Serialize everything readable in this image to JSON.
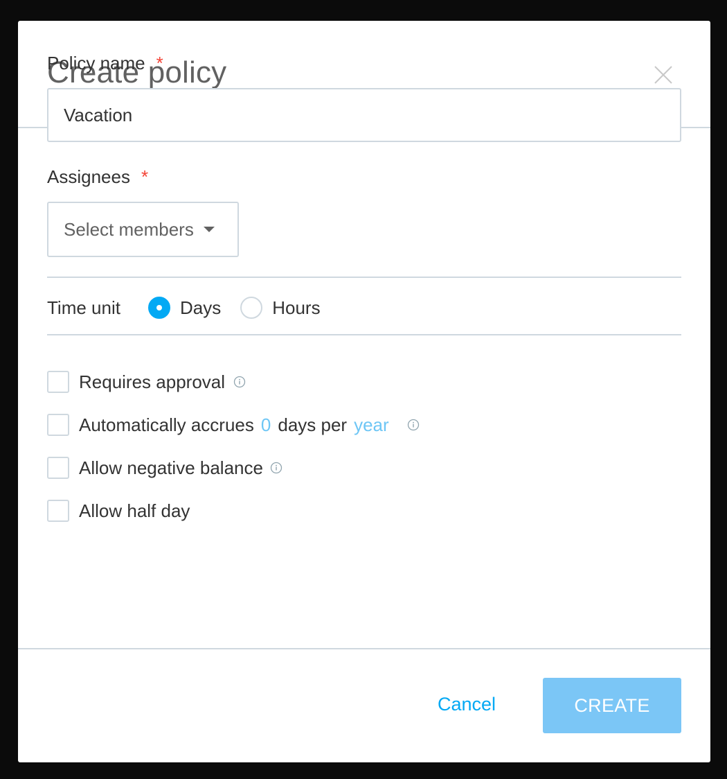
{
  "modal": {
    "title": "Create policy",
    "close_icon": "close-icon"
  },
  "form": {
    "policy_name": {
      "label": "Policy name",
      "required_mark": "*",
      "value": "Vacation"
    },
    "assignees": {
      "label": "Assignees",
      "required_mark": "*",
      "placeholder": "Select members",
      "icon": "chevron-down-icon"
    },
    "time_unit": {
      "label": "Time unit",
      "options": [
        {
          "label": "Days",
          "selected": true
        },
        {
          "label": "Hours",
          "selected": false
        }
      ]
    },
    "options": [
      {
        "label": "Requires approval",
        "checked": false,
        "info_icon": true
      },
      {
        "label_prefix": "Automatically accrues",
        "amount": "0",
        "label_middle": "days per",
        "period": "year",
        "checked": false,
        "info_icon": true
      },
      {
        "label": "Allow negative balance",
        "checked": false,
        "info_icon": true
      },
      {
        "label": "Allow half day",
        "checked": false,
        "info_icon": false
      }
    ]
  },
  "footer": {
    "cancel_label": "Cancel",
    "create_label": "CREATE"
  },
  "colors": {
    "accent": "#03a9f4",
    "accent_light": "#6ec6f5",
    "button_disabled": "#7bc6f6",
    "required": "#f44336",
    "border": "#cfd8df"
  }
}
